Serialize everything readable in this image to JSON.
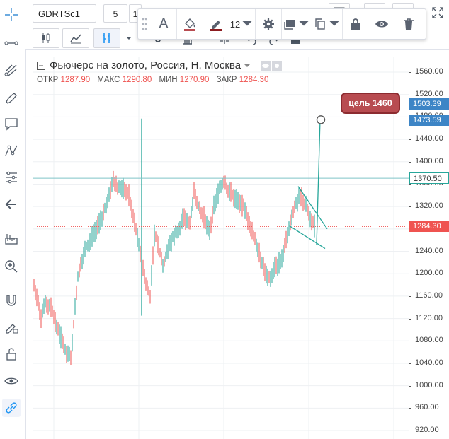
{
  "header": {
    "symbol": "GDRTSc1",
    "interval": "5",
    "interval2": "1"
  },
  "float_toolbar": {
    "text_label": "A",
    "line_width": "12"
  },
  "legend": {
    "title": "Фьючерс на золото, Россия, Н, Москва",
    "open_label": "ОТКР",
    "open": "1287.90",
    "high_label": "МАКС",
    "high": "1290.80",
    "low_label": "МИН",
    "low": "1270.90",
    "close_label": "ЗАКР",
    "close": "1284.30"
  },
  "callout": {
    "text": "цель 1460"
  },
  "price_scale": {
    "ticks": [
      "1560.00",
      "1520.00",
      "1480.00",
      "1440.00",
      "1400.00",
      "1360.00",
      "1320.00",
      "1280.00",
      "1240.00",
      "1200.00",
      "1160.00",
      "1120.00",
      "1080.00",
      "1040.00",
      "1000.00",
      "960.00",
      "920.00"
    ],
    "labels": [
      {
        "value": "1503.39",
        "color": "#3d85c6"
      },
      {
        "value": "1473.59",
        "color": "#3d85c6"
      },
      {
        "value": "1370.50",
        "color": "#ffffff"
      },
      {
        "value": "1284.30",
        "color": "#ef5350"
      }
    ]
  },
  "colors": {
    "up": "#26a69a",
    "down": "#ef5350",
    "drawing": "#26a69a",
    "last_price": "#ef5350"
  },
  "chart_data": {
    "type": "candlestick",
    "last_price": 1284.3,
    "horizontal_level": 1370.5,
    "target": 1460,
    "ylim": [
      900,
      1580
    ]
  }
}
